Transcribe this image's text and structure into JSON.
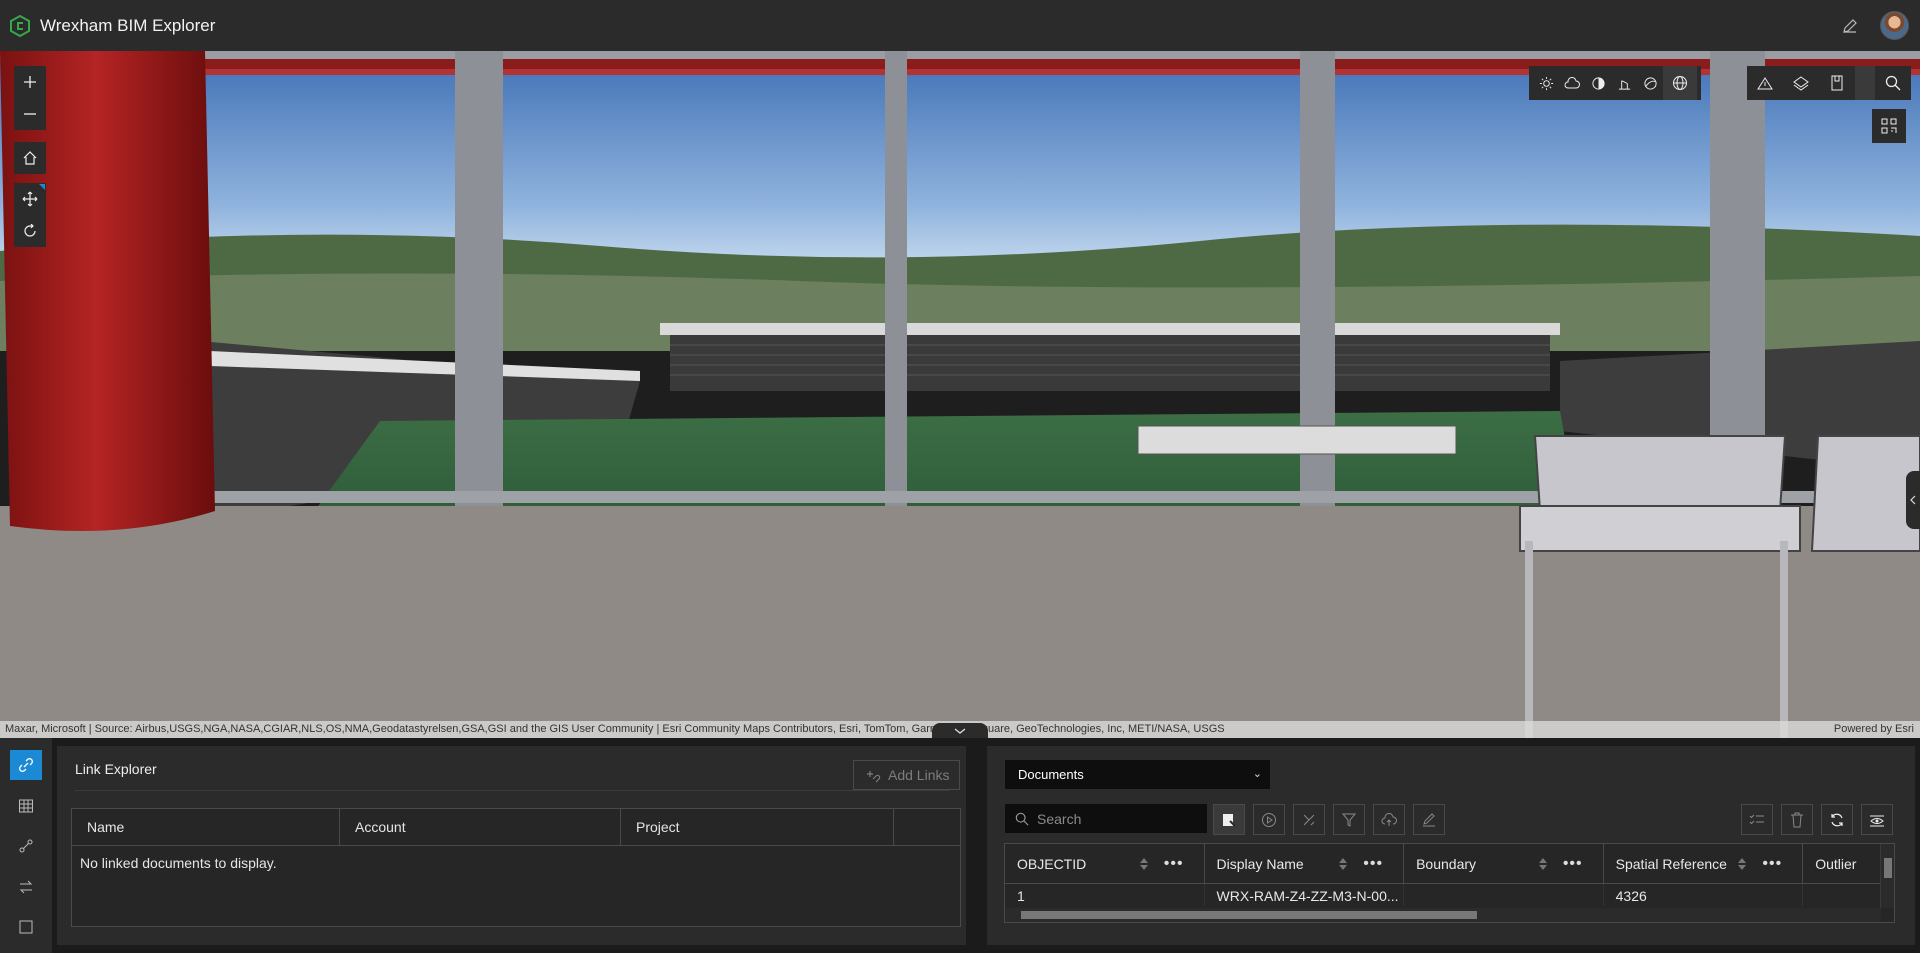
{
  "app": {
    "title": "Wrexham BIM Explorer",
    "brand_color": "#35a84a"
  },
  "header": {
    "edit_icon": "pencil-icon",
    "avatar_icon": "user-avatar"
  },
  "map_tools": {
    "zoom_in": "plus-icon",
    "zoom_out": "minus-icon",
    "home": "home-icon",
    "pan": "move-icon",
    "rotate": "rotate-icon",
    "top_tools": [
      "daylight-icon",
      "weather-icon",
      "shadow-cast-icon",
      "line-of-sight-icon",
      "slice-icon",
      "basemap-gallery-icon"
    ],
    "right_tools": [
      "elevation-profile-icon",
      "layers-icon",
      "bookmark-icon",
      "search-icon"
    ],
    "qr_icon": "qr-code-icon"
  },
  "attribution": {
    "text": "Maxar, Microsoft | Source: Airbus,USGS,NGA,NASA,CGIAR,NLS,OS,NMA,Geodatastyrelsen,GSA,GSI and the GIS User Community | Esri Community Maps Contributors, Esri, TomTom, Garmin, Foursquare, GeoTechnologies, Inc, METI/NASA, USGS",
    "powered_by": "Powered by Esri"
  },
  "side_rail": {
    "items": [
      "link-icon",
      "table-icon",
      "connection-icon",
      "swap-icon",
      "square-icon"
    ],
    "active_index": 0,
    "active_color": "#1c89d4"
  },
  "link_explorer": {
    "title": "Link Explorer",
    "add_links_label": "Add Links",
    "columns": [
      "Name",
      "Account",
      "Project",
      ""
    ],
    "empty_message": "No linked documents to display."
  },
  "documents": {
    "selected": "Documents",
    "search_placeholder": "Search",
    "actions": [
      "show-selection-icon",
      "play-icon",
      "zoom-to-icon",
      "filter-icon",
      "upload-icon",
      "edit-icon"
    ],
    "right_actions": [
      "select-all-icon",
      "delete-icon",
      "refresh-icon",
      "visibility-icon"
    ],
    "columns": [
      "OBJECTID",
      "Display Name",
      "Boundary",
      "Spatial Reference",
      "Outlier"
    ],
    "rows": [
      [
        "1",
        "WRX-RAM-Z4-ZZ-M3-N-00...",
        "",
        "4326",
        ""
      ]
    ]
  }
}
